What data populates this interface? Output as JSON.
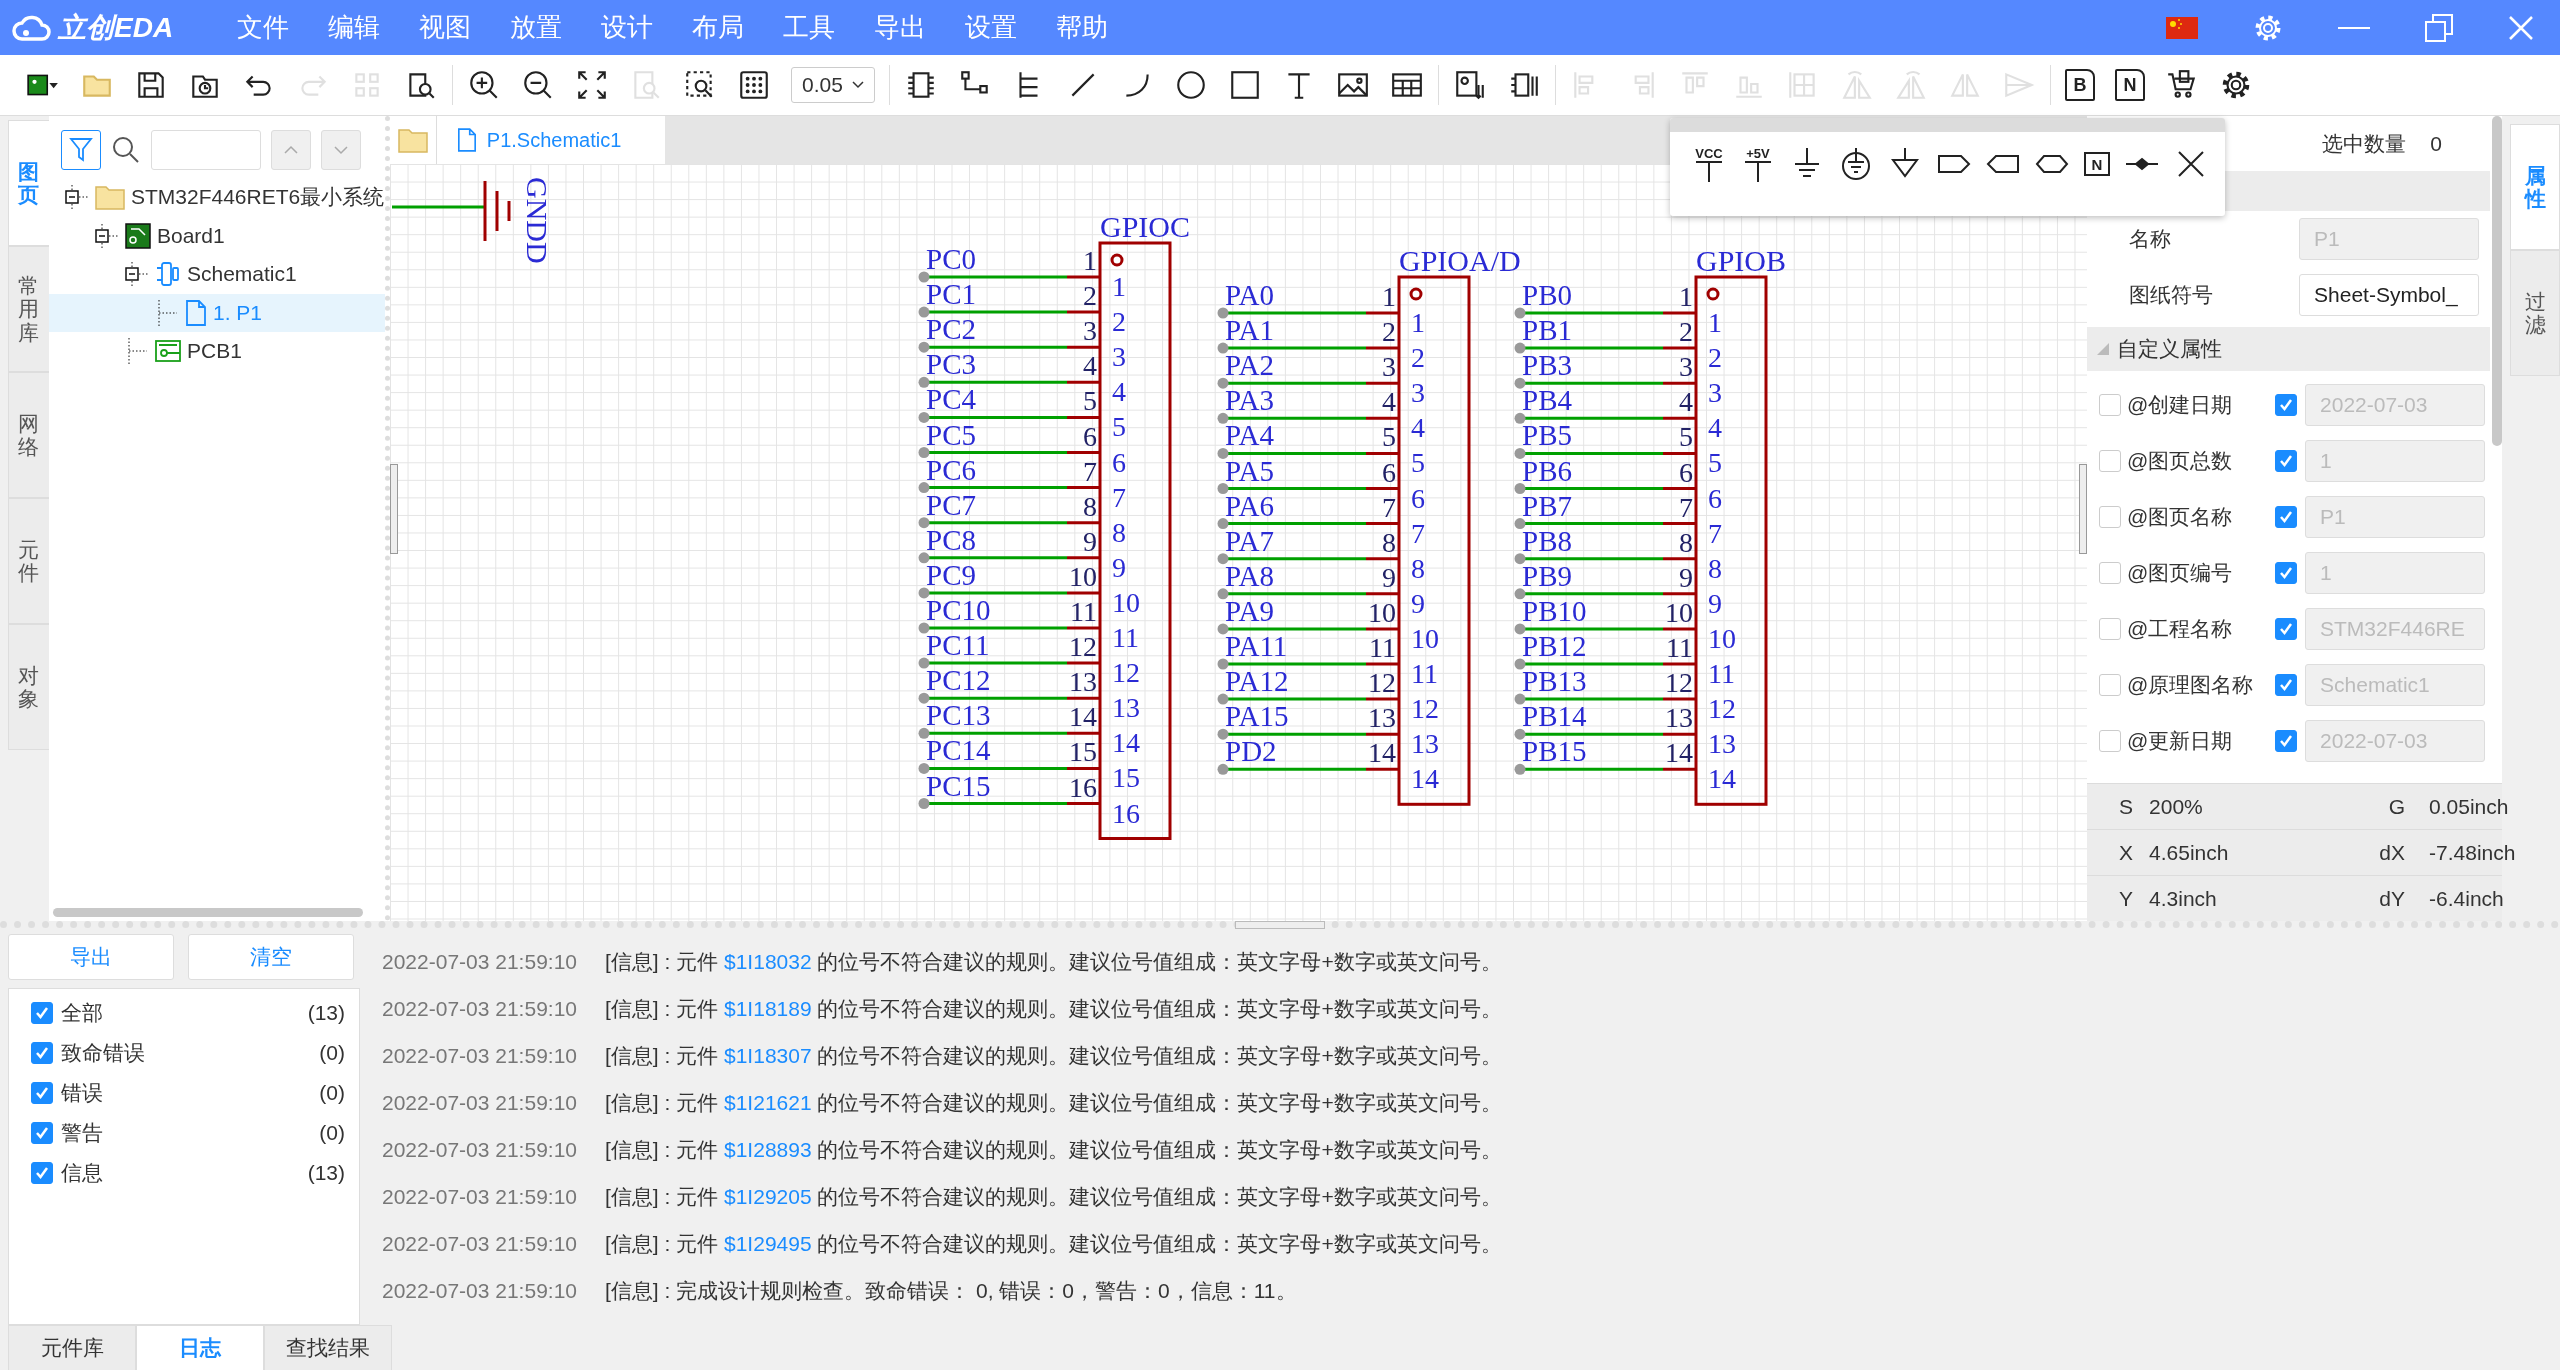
{
  "title_bar": {
    "logo": "立创EDA",
    "menu": [
      "文件",
      "编辑",
      "视图",
      "放置",
      "设计",
      "布局",
      "工具",
      "导出",
      "设置",
      "帮助"
    ]
  },
  "toolbar": {
    "grid_size": "0.05",
    "groups": [
      {
        "tools": [
          {
            "disabled": false
          },
          {
            "disabled": false
          },
          {
            "disabled": false
          },
          {
            "disabled": false
          },
          {
            "disabled": false
          },
          {
            "disabled": true
          },
          {
            "disabled": true
          },
          {
            "disabled": false
          }
        ]
      },
      {
        "tools": [
          {
            "disabled": false
          },
          {
            "disabled": false
          },
          {
            "disabled": false
          },
          {
            "disabled": true
          },
          {
            "disabled": false
          },
          {
            "disabled": false
          }
        ]
      },
      {
        "tools": [
          {
            "disabled": false
          },
          {
            "disabled": false
          },
          {
            "disabled": false
          },
          {
            "disabled": false
          },
          {
            "disabled": false
          },
          {
            "disabled": false
          },
          {
            "disabled": false
          },
          {
            "disabled": false
          },
          {
            "disabled": false
          },
          {
            "disabled": false
          }
        ]
      },
      {
        "tools": [
          {
            "disabled": false
          },
          {
            "disabled": false
          }
        ]
      },
      {
        "tools": [
          {
            "disabled": true
          },
          {
            "disabled": true
          },
          {
            "disabled": true
          },
          {
            "disabled": true
          },
          {
            "disabled": true
          },
          {
            "disabled": true
          },
          {
            "disabled": true
          },
          {
            "disabled": true
          },
          {
            "disabled": true
          }
        ]
      },
      {
        "tools": [
          {
            "disabled": false,
            "label": "B"
          },
          {
            "disabled": false,
            "label": "N"
          },
          {
            "disabled": false
          },
          {
            "disabled": false
          }
        ]
      }
    ]
  },
  "left_tabs": [
    {
      "label": "图页",
      "selected": true
    },
    {
      "label": "常用库",
      "selected": false
    },
    {
      "label": "网络",
      "selected": false
    },
    {
      "label": "元件",
      "selected": false
    },
    {
      "label": "对象",
      "selected": false
    }
  ],
  "tree": [
    {
      "label": "STM32F446RET6最小系统",
      "kind": "project",
      "expanded": true,
      "selected": false,
      "children": [
        {
          "label": "Board1",
          "kind": "board",
          "expanded": true,
          "selected": false,
          "children": [
            {
              "label": "Schematic1",
              "kind": "schematic",
              "expanded": true,
              "selected": false,
              "children": [
                {
                  "label": "1. P1",
                  "kind": "sheet",
                  "selected": true
                }
              ]
            },
            {
              "label": "PCB1",
              "kind": "pcb",
              "selected": false
            }
          ]
        }
      ]
    }
  ],
  "document_tabs": [
    {
      "label": "P1.Schematic1",
      "selected": true
    }
  ],
  "symbol_palette": {
    "labels": [
      "VCC",
      "+5V"
    ],
    "flag_label": "N"
  },
  "schematic": {
    "ground_label": "GNDD",
    "components": [
      {
        "title": "GPIOC",
        "pins": [
          {
            "name": "PC0",
            "number": "1",
            "inner": "1"
          },
          {
            "name": "PC1",
            "number": "2",
            "inner": "2"
          },
          {
            "name": "PC2",
            "number": "3",
            "inner": "3"
          },
          {
            "name": "PC3",
            "number": "4",
            "inner": "4"
          },
          {
            "name": "PC4",
            "number": "5",
            "inner": "5"
          },
          {
            "name": "PC5",
            "number": "6",
            "inner": "6"
          },
          {
            "name": "PC6",
            "number": "7",
            "inner": "7"
          },
          {
            "name": "PC7",
            "number": "8",
            "inner": "8"
          },
          {
            "name": "PC8",
            "number": "9",
            "inner": "9"
          },
          {
            "name": "PC9",
            "number": "10",
            "inner": "10"
          },
          {
            "name": "PC10",
            "number": "11",
            "inner": "11"
          },
          {
            "name": "PC11",
            "number": "12",
            "inner": "12"
          },
          {
            "name": "PC12",
            "number": "13",
            "inner": "13"
          },
          {
            "name": "PC13",
            "number": "14",
            "inner": "14"
          },
          {
            "name": "PC14",
            "number": "15",
            "inner": "15"
          },
          {
            "name": "PC15",
            "number": "16",
            "inner": "16"
          }
        ]
      },
      {
        "title": "GPIOA/D",
        "pins": [
          {
            "name": "PA0",
            "number": "1",
            "inner": "1"
          },
          {
            "name": "PA1",
            "number": "2",
            "inner": "2"
          },
          {
            "name": "PA2",
            "number": "3",
            "inner": "3"
          },
          {
            "name": "PA3",
            "number": "4",
            "inner": "4"
          },
          {
            "name": "PA4",
            "number": "5",
            "inner": "5"
          },
          {
            "name": "PA5",
            "number": "6",
            "inner": "6"
          },
          {
            "name": "PA6",
            "number": "7",
            "inner": "7"
          },
          {
            "name": "PA7",
            "number": "8",
            "inner": "8"
          },
          {
            "name": "PA8",
            "number": "9",
            "inner": "9"
          },
          {
            "name": "PA9",
            "number": "10",
            "inner": "10"
          },
          {
            "name": "PA11",
            "number": "11",
            "inner": "11"
          },
          {
            "name": "PA12",
            "number": "12",
            "inner": "12"
          },
          {
            "name": "PA15",
            "number": "13",
            "inner": "13"
          },
          {
            "name": "PD2",
            "number": "14",
            "inner": "14"
          }
        ]
      },
      {
        "title": "GPIOB",
        "pins": [
          {
            "name": "PB0",
            "number": "1",
            "inner": "1"
          },
          {
            "name": "PB1",
            "number": "2",
            "inner": "2"
          },
          {
            "name": "PB3",
            "number": "3",
            "inner": "3"
          },
          {
            "name": "PB4",
            "number": "4",
            "inner": "4"
          },
          {
            "name": "PB5",
            "number": "5",
            "inner": "5"
          },
          {
            "name": "PB6",
            "number": "6",
            "inner": "6"
          },
          {
            "name": "PB7",
            "number": "7",
            "inner": "7"
          },
          {
            "name": "PB8",
            "number": "8",
            "inner": "8"
          },
          {
            "name": "PB9",
            "number": "9",
            "inner": "9"
          },
          {
            "name": "PB10",
            "number": "10",
            "inner": "10"
          },
          {
            "name": "PB12",
            "number": "11",
            "inner": "11"
          },
          {
            "name": "PB13",
            "number": "12",
            "inner": "12"
          },
          {
            "name": "PB14",
            "number": "13",
            "inner": "13"
          },
          {
            "name": "PB15",
            "number": "14",
            "inner": "14"
          }
        ]
      }
    ]
  },
  "properties": {
    "selected_count_label": "选中数量",
    "selected_count": "0",
    "fields": [
      {
        "label": "名称",
        "value": "P1",
        "disabled": true
      },
      {
        "label": "图纸符号",
        "value": "Sheet-Symbol_",
        "disabled": false
      }
    ],
    "custom_section": {
      "title": "自定义属性",
      "expanded": true,
      "rows": [
        {
          "label": "@创建日期",
          "show_name": false,
          "show_value": true,
          "value": "2022-07-03"
        },
        {
          "label": "@图页总数",
          "show_name": false,
          "show_value": true,
          "value": "1"
        },
        {
          "label": "@图页名称",
          "show_name": false,
          "show_value": true,
          "value": "P1"
        },
        {
          "label": "@图页编号",
          "show_name": false,
          "show_value": true,
          "value": "1"
        },
        {
          "label": "@工程名称",
          "show_name": false,
          "show_value": true,
          "value": "STM32F446RE"
        },
        {
          "label": "@原理图名称",
          "show_name": false,
          "show_value": true,
          "value": "Schematic1"
        },
        {
          "label": "@更新日期",
          "show_name": false,
          "show_value": true,
          "value": "2022-07-03"
        }
      ]
    },
    "status": [
      {
        "key": "S",
        "value": "200%",
        "key2": "G",
        "value2": "0.05inch"
      },
      {
        "key": "X",
        "value": "4.65inch",
        "key2": "dX",
        "value2": "-7.48inch"
      },
      {
        "key": "Y",
        "value": "4.3inch",
        "key2": "dY",
        "value2": "-6.4inch"
      }
    ]
  },
  "right_tabs": [
    {
      "label": "属性",
      "selected": true
    },
    {
      "label": "过滤",
      "selected": false
    }
  ],
  "log_panel": {
    "buttons": [
      "导出",
      "清空"
    ],
    "filters": [
      {
        "label": "全部",
        "count": "(13)",
        "checked": true
      },
      {
        "label": "致命错误",
        "count": "(0)",
        "checked": true
      },
      {
        "label": "错误",
        "count": "(0)",
        "checked": true
      },
      {
        "label": "警告",
        "count": "(0)",
        "checked": true
      },
      {
        "label": "信息",
        "count": "(13)",
        "checked": true
      }
    ],
    "entries": [
      {
        "time": "2022-07-03 21:59:10",
        "message": "[信息] : 元件 ",
        "link": "$1I18032",
        "after": " 的位号不符合建议的规则。建议位号值组成：英文字母+数字或英文问号。"
      },
      {
        "time": "2022-07-03 21:59:10",
        "message": "[信息] : 元件 ",
        "link": "$1I18189",
        "after": " 的位号不符合建议的规则。建议位号值组成：英文字母+数字或英文问号。"
      },
      {
        "time": "2022-07-03 21:59:10",
        "message": "[信息] : 元件 ",
        "link": "$1I18307",
        "after": " 的位号不符合建议的规则。建议位号值组成：英文字母+数字或英文问号。"
      },
      {
        "time": "2022-07-03 21:59:10",
        "message": "[信息] : 元件 ",
        "link": "$1I21621",
        "after": " 的位号不符合建议的规则。建议位号值组成：英文字母+数字或英文问号。"
      },
      {
        "time": "2022-07-03 21:59:10",
        "message": "[信息] : 元件 ",
        "link": "$1I28893",
        "after": " 的位号不符合建议的规则。建议位号值组成：英文字母+数字或英文问号。"
      },
      {
        "time": "2022-07-03 21:59:10",
        "message": "[信息] : 元件 ",
        "link": "$1I29205",
        "after": " 的位号不符合建议的规则。建议位号值组成：英文字母+数字或英文问号。"
      },
      {
        "time": "2022-07-03 21:59:10",
        "message": "[信息] : 元件 ",
        "link": "$1I29495",
        "after": " 的位号不符合建议的规则。建议位号值组成：英文字母+数字或英文问号。"
      },
      {
        "time": "2022-07-03 21:59:10",
        "message": "[信息] : 完成设计规则检查。致命错误： 0, 错误：0，警告：0，信息：11。"
      }
    ]
  },
  "bottom_tabs": [
    {
      "label": "元件库",
      "selected": false
    },
    {
      "label": "日志",
      "selected": true
    },
    {
      "label": "查找结果",
      "selected": false
    }
  ]
}
